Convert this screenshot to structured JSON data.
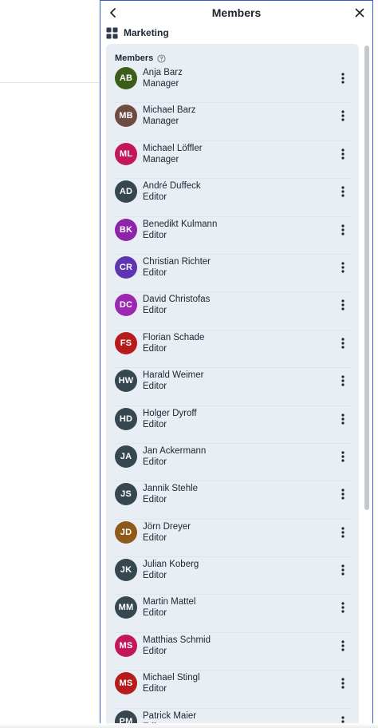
{
  "panel": {
    "title": "Members",
    "back_icon": "chevron-left-icon",
    "close_icon": "close-icon",
    "accent_color": "#2f5fd0"
  },
  "group": {
    "name": "Marketing",
    "icon": "grid-icon"
  },
  "members_section": {
    "label": "Members",
    "help_icon": "help-circle-icon"
  },
  "members": [
    {
      "initials": "AB",
      "name": "Anja Barz",
      "role": "Manager",
      "color": "#3d5d1b"
    },
    {
      "initials": "MB",
      "name": "Michael Barz",
      "role": "Manager",
      "color": "#6d4c41"
    },
    {
      "initials": "ML",
      "name": "Michael Löffler",
      "role": "Manager",
      "color": "#c2185b"
    },
    {
      "initials": "AD",
      "name": "André Duffeck",
      "role": "Editor",
      "color": "#37474f"
    },
    {
      "initials": "BK",
      "name": "Benedikt Kulmann",
      "role": "Editor",
      "color": "#8e24aa"
    },
    {
      "initials": "CR",
      "name": "Christian Richter",
      "role": "Editor",
      "color": "#5e35b1"
    },
    {
      "initials": "DC",
      "name": "David Christofas",
      "role": "Editor",
      "color": "#9c27b0"
    },
    {
      "initials": "FS",
      "name": "Florian Schade",
      "role": "Editor",
      "color": "#b71c1c"
    },
    {
      "initials": "HW",
      "name": "Harald Weimer",
      "role": "Editor",
      "color": "#37474f"
    },
    {
      "initials": "HD",
      "name": "Holger Dyroff",
      "role": "Editor",
      "color": "#37474f"
    },
    {
      "initials": "JA",
      "name": "Jan Ackermann",
      "role": "Editor",
      "color": "#37474f"
    },
    {
      "initials": "JS",
      "name": "Jannik Stehle",
      "role": "Editor",
      "color": "#37474f"
    },
    {
      "initials": "JD",
      "name": "Jörn Dreyer",
      "role": "Editor",
      "color": "#8d5a1a"
    },
    {
      "initials": "JK",
      "name": "Julian Koberg",
      "role": "Editor",
      "color": "#37474f"
    },
    {
      "initials": "MM",
      "name": "Martin Mattel",
      "role": "Editor",
      "color": "#37474f"
    },
    {
      "initials": "MS",
      "name": "Matthias Schmid",
      "role": "Editor",
      "color": "#c2185b"
    },
    {
      "initials": "MS",
      "name": "Michael Stingl",
      "role": "Editor",
      "color": "#b71c1c"
    },
    {
      "initials": "PM",
      "name": "Patrick Maier",
      "role": "Editor",
      "color": "#37474f"
    }
  ],
  "row_menu_icon": "kebab-menu-icon"
}
